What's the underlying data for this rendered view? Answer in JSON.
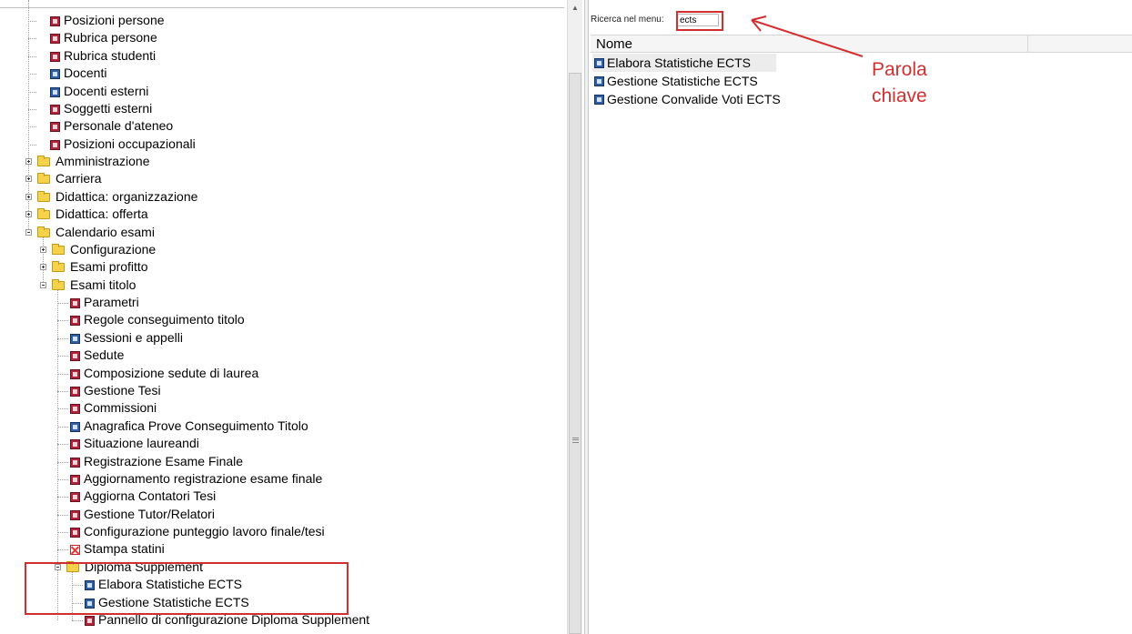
{
  "tree": {
    "items": [
      {
        "label": "Posizioni persone",
        "icon": "red-form-icon"
      },
      {
        "label": "Rubrica persone",
        "icon": "red-form-icon"
      },
      {
        "label": "Rubrica studenti",
        "icon": "red-form-icon"
      },
      {
        "label": "Docenti",
        "icon": "blue-form-icon"
      },
      {
        "label": "Docenti esterni",
        "icon": "blue-form-icon"
      },
      {
        "label": "Soggetti esterni",
        "icon": "red-form-icon"
      },
      {
        "label": "Personale d'ateneo",
        "icon": "red-form-icon"
      },
      {
        "label": "Posizioni occupazionali",
        "icon": "red-form-icon"
      },
      {
        "label": "Amministrazione",
        "icon": "folder-icon",
        "expanded": false
      },
      {
        "label": "Carriera",
        "icon": "folder-icon",
        "expanded": false
      },
      {
        "label": "Didattica: organizzazione",
        "icon": "folder-icon",
        "expanded": false
      },
      {
        "label": "Didattica: offerta",
        "icon": "folder-icon",
        "expanded": false
      },
      {
        "label": "Calendario esami",
        "icon": "folder-icon",
        "expanded": true
      },
      {
        "label": "Configurazione",
        "icon": "folder-icon",
        "expanded": false
      },
      {
        "label": "Esami profitto",
        "icon": "folder-icon",
        "expanded": false
      },
      {
        "label": "Esami titolo",
        "icon": "folder-icon",
        "expanded": true
      },
      {
        "label": "Parametri",
        "icon": "red-form-icon"
      },
      {
        "label": "Regole conseguimento titolo",
        "icon": "red-form-icon"
      },
      {
        "label": "Sessioni e appelli",
        "icon": "blue-form-icon"
      },
      {
        "label": "Sedute",
        "icon": "red-form-icon"
      },
      {
        "label": "Composizione sedute di laurea",
        "icon": "red-form-icon"
      },
      {
        "label": "Gestione Tesi",
        "icon": "red-form-icon"
      },
      {
        "label": "Commissioni",
        "icon": "red-form-icon"
      },
      {
        "label": "Anagrafica Prove Conseguimento Titolo",
        "icon": "blue-form-icon"
      },
      {
        "label": "Situazione laureandi",
        "icon": "red-form-icon"
      },
      {
        "label": "Registrazione Esame Finale",
        "icon": "red-form-icon"
      },
      {
        "label": "Aggiornamento registrazione esame finale",
        "icon": "red-form-icon"
      },
      {
        "label": "Aggiorna Contatori Tesi",
        "icon": "red-form-icon"
      },
      {
        "label": "Gestione Tutor/Relatori",
        "icon": "red-form-icon"
      },
      {
        "label": "Configurazione punteggio lavoro finale/tesi",
        "icon": "red-form-icon"
      },
      {
        "label": "Stampa statini",
        "icon": "red-cross-icon"
      },
      {
        "label": "Diploma Supplement",
        "icon": "folder-icon",
        "expanded": true
      },
      {
        "label": "Elabora Statistiche ECTS",
        "icon": "blue-form-icon"
      },
      {
        "label": "Gestione Statistiche ECTS",
        "icon": "blue-form-icon"
      },
      {
        "label": "Pannello di configurazione Diploma Supplement",
        "icon": "red-form-icon"
      }
    ]
  },
  "search": {
    "label": "Ricerca nel menu:",
    "value": "ects"
  },
  "results": {
    "column_header": "Nome",
    "rows": [
      {
        "label": "Elabora Statistiche ECTS",
        "icon": "blue-form-icon",
        "selected": true
      },
      {
        "label": "Gestione Statistiche ECTS",
        "icon": "blue-form-icon",
        "selected": false
      },
      {
        "label": "Gestione Convalide Voti ECTS",
        "icon": "blue-form-icon",
        "selected": false
      }
    ]
  },
  "annotation": {
    "line1": "Parola",
    "line2": "chiave"
  },
  "colors": {
    "annotation_red": "#d32f2f",
    "form_red": "#b1253a",
    "form_blue": "#2f5fa8",
    "folder_yellow": "#f6d14a"
  }
}
